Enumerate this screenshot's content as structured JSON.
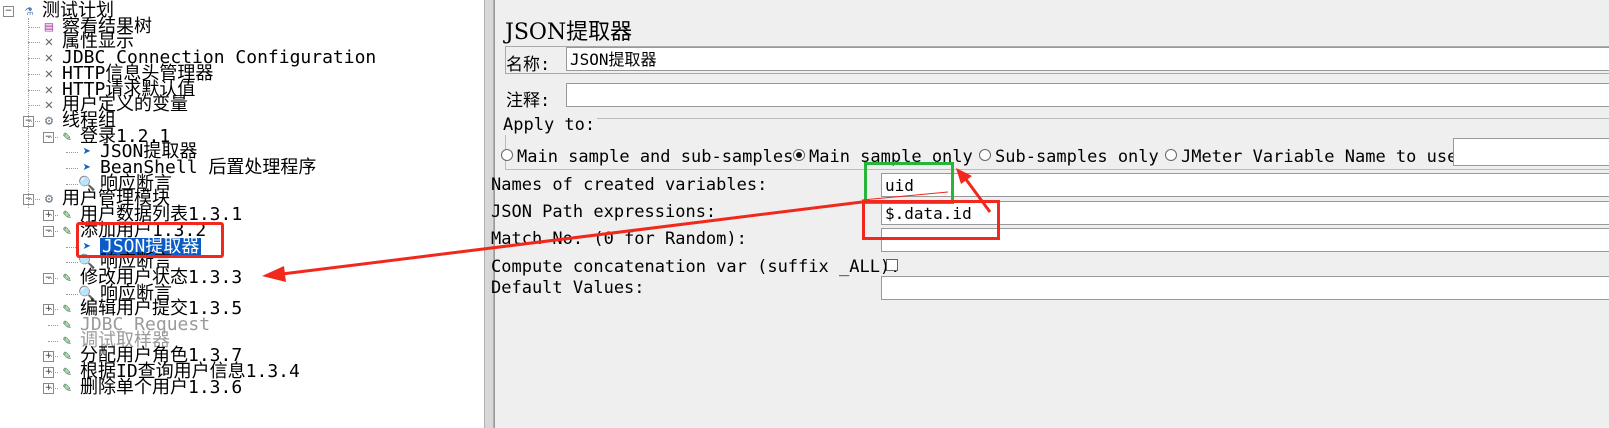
{
  "tree": {
    "items": [
      {
        "label": "测试计划",
        "icon": "flask-icon",
        "depth": 0,
        "toggle": "-"
      },
      {
        "label": "察看结果树",
        "icon": "chart-icon",
        "depth": 1,
        "toggle": ""
      },
      {
        "label": "属性显示",
        "icon": "wrench-icon",
        "depth": 1,
        "toggle": ""
      },
      {
        "label": "JDBC Connection Configuration",
        "icon": "wrench-icon",
        "depth": 1,
        "toggle": ""
      },
      {
        "label": "HTTP信息头管理器",
        "icon": "wrench-icon",
        "depth": 1,
        "toggle": ""
      },
      {
        "label": "HTTP请求默认值",
        "icon": "wrench-icon",
        "depth": 1,
        "toggle": ""
      },
      {
        "label": "用户定义的变量",
        "icon": "wrench-icon",
        "depth": 1,
        "toggle": ""
      },
      {
        "label": "线程组",
        "icon": "gear-icon",
        "depth": 1,
        "toggle": "-"
      },
      {
        "label": "登录1.2.1",
        "icon": "pen-icon",
        "depth": 2,
        "toggle": "-"
      },
      {
        "label": "JSON提取器",
        "icon": "arrow-icon",
        "depth": 3,
        "toggle": ""
      },
      {
        "label": "BeanShell 后置处理程序",
        "icon": "arrow-icon",
        "depth": 3,
        "toggle": ""
      },
      {
        "label": "响应断言",
        "icon": "magnifier-icon",
        "depth": 3,
        "toggle": ""
      },
      {
        "label": "用户管理模块",
        "icon": "gear-icon",
        "depth": 1,
        "toggle": "-"
      },
      {
        "label": "用户数据列表1.3.1",
        "icon": "pen-icon",
        "depth": 2,
        "toggle": "+"
      },
      {
        "label": "添加用户1.3.2",
        "icon": "pen-icon",
        "depth": 2,
        "toggle": "-"
      },
      {
        "label": "JSON提取器",
        "icon": "arrow-icon",
        "depth": 3,
        "toggle": "",
        "selected": true
      },
      {
        "label": "响应断言",
        "icon": "magnifier-icon",
        "depth": 3,
        "toggle": ""
      },
      {
        "label": "修改用户状态1.3.3",
        "icon": "pen-icon",
        "depth": 2,
        "toggle": "-"
      },
      {
        "label": "响应断言",
        "icon": "magnifier-icon",
        "depth": 3,
        "toggle": ""
      },
      {
        "label": "编辑用户提交1.3.5",
        "icon": "pen-icon",
        "depth": 2,
        "toggle": "+"
      },
      {
        "label": "JDBC Request",
        "icon": "pen-icon",
        "depth": 2,
        "toggle": "",
        "disabled": true
      },
      {
        "label": "调试取样器",
        "icon": "pen-icon",
        "depth": 2,
        "toggle": "",
        "disabled": true
      },
      {
        "label": "分配用户角色1.3.7",
        "icon": "pen-icon",
        "depth": 2,
        "toggle": "+"
      },
      {
        "label": "根据ID查询用户信息1.3.4",
        "icon": "pen-icon",
        "depth": 2,
        "toggle": "+"
      },
      {
        "label": "删除单个用户1.3.6",
        "icon": "pen-icon",
        "depth": 2,
        "toggle": "+"
      }
    ]
  },
  "panel": {
    "title": "JSON提取器",
    "name_label": "名称:",
    "name_value": "JSON提取器",
    "comment_label": "注释:",
    "comment_value": "",
    "apply_to": {
      "legend": "Apply to:",
      "options": [
        {
          "label": "Main sample and sub-samples",
          "checked": false
        },
        {
          "label": "Main sample only",
          "checked": true
        },
        {
          "label": "Sub-samples only",
          "checked": false
        },
        {
          "label": "JMeter Variable Name to use",
          "checked": false
        }
      ],
      "variable_value": ""
    },
    "fields": {
      "names_label": "Names of created variables:",
      "names_value": "uid",
      "paths_label": "JSON Path expressions:",
      "paths_value": "$.data.id",
      "match_label": "Match No. (0 for Random):",
      "match_value": "",
      "concat_label": "Compute concatenation var (suffix _ALL):",
      "concat_checked": false,
      "default_label": "Default Values:",
      "default_value": ""
    }
  },
  "annotations": {
    "red_color": "#f0281e",
    "green_color": "#27b53a"
  }
}
